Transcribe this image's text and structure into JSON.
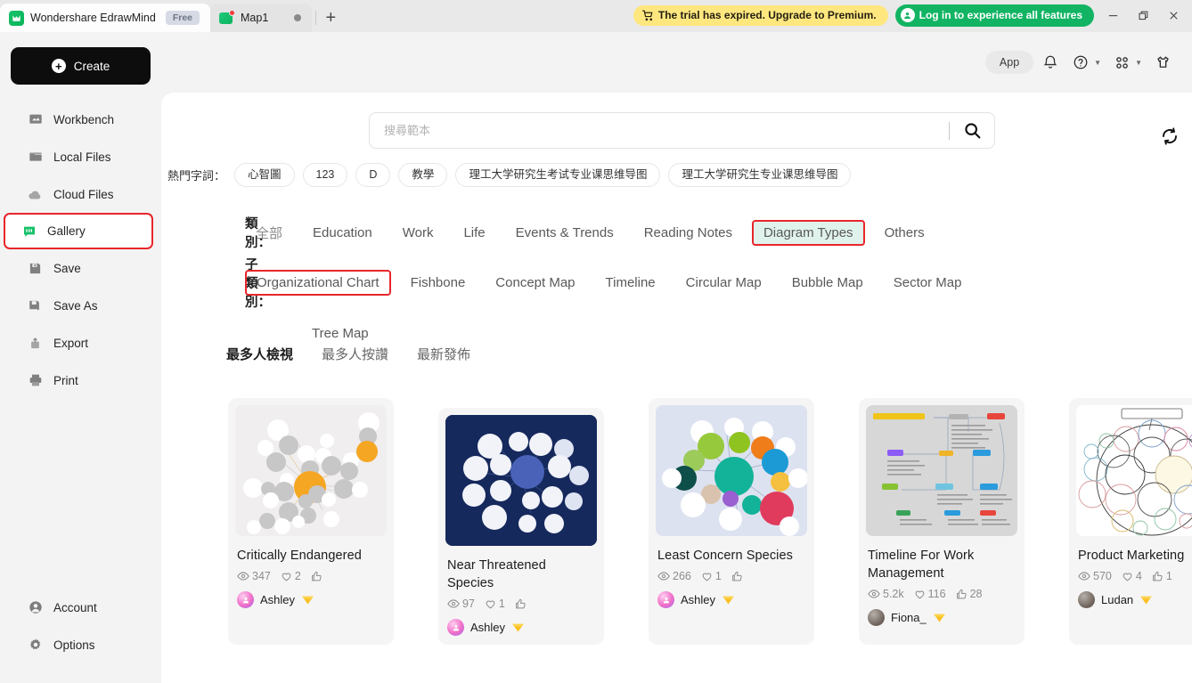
{
  "titlebar": {
    "app_name": "Wondershare EdrawMind",
    "free_badge": "Free",
    "doc_tab": "Map1",
    "add_tab_label": "+",
    "trial_notice": "The trial has expired. Upgrade to Premium.",
    "login_label": "Log in to experience all features",
    "minimize": "minimize-icon",
    "restore": "restore-icon",
    "close": "close-icon"
  },
  "sidebar": {
    "create_label": "Create",
    "items": [
      {
        "label": "Workbench",
        "icon": "workbench-icon"
      },
      {
        "label": "Local Files",
        "icon": "folder-icon"
      },
      {
        "label": "Cloud Files",
        "icon": "cloud-icon"
      },
      {
        "label": "Gallery",
        "icon": "gallery-icon",
        "highlighted": true
      },
      {
        "label": "Save",
        "icon": "save-icon"
      },
      {
        "label": "Save As",
        "icon": "save-as-icon"
      },
      {
        "label": "Export",
        "icon": "export-icon"
      },
      {
        "label": "Print",
        "icon": "print-icon"
      }
    ],
    "bottom_items": [
      {
        "label": "Account",
        "icon": "account-icon"
      },
      {
        "label": "Options",
        "icon": "gear-icon"
      }
    ]
  },
  "topbar": {
    "app_button": "App",
    "bell": "bell-icon",
    "help": "help-icon",
    "apps_grid": "grid-icon",
    "shirt": "shirt-icon"
  },
  "search": {
    "placeholder": "搜尋範本",
    "value": "",
    "search_icon": "search-icon",
    "refresh_icon": "refresh-icon"
  },
  "hot_keywords": {
    "label": "熱門字詞：",
    "items": [
      "心智圖",
      "123",
      "D",
      "教學",
      "理工大学研究生考试专业课思维导图",
      "理工大学研究生专业课思维导图"
    ]
  },
  "categories": {
    "label": "類別：",
    "items": [
      "全部",
      "Education",
      "Work",
      "Life",
      "Events & Trends",
      "Reading Notes",
      "Diagram Types",
      "Others"
    ],
    "selected": "Diagram Types",
    "highlight_color": "#e8262b",
    "selected_bg": "#e0f2ec"
  },
  "subcategories": {
    "label": "子類別：",
    "items": [
      "Organizational Chart",
      "Fishbone",
      "Concept Map",
      "Timeline",
      "Circular Map",
      "Bubble Map",
      "Sector Map",
      "Tree Map"
    ],
    "selected": "Organizational Chart"
  },
  "sort_tabs": {
    "items": [
      "最多人檢視",
      "最多人按讚",
      "最新發佈"
    ],
    "active": "最多人檢視"
  },
  "cards": [
    {
      "title": "Critically Endangered",
      "views": "347",
      "likes": "2",
      "thumbs": "",
      "author": "Ashley",
      "vip": true,
      "thumb_bg": "#f0eeee",
      "thumb_kind": "bubble-grey"
    },
    {
      "title": "Near Threatened Species",
      "views": "97",
      "likes": "1",
      "thumbs": "",
      "author": "Ashley",
      "vip": true,
      "thumb_bg": "#16295c",
      "thumb_kind": "bubble-navy"
    },
    {
      "title": "Least Concern Species",
      "views": "266",
      "likes": "1",
      "thumbs": "",
      "author": "Ashley",
      "vip": true,
      "thumb_bg": "#dde2f0",
      "thumb_kind": "bubble-color"
    },
    {
      "title": "Timeline For Work Management",
      "views": "5.2k",
      "likes": "116",
      "thumbs": "28",
      "author": "Fiona_",
      "vip": true,
      "thumb_bg": "#d7d7d7",
      "thumb_kind": "timeline"
    },
    {
      "title": "Product Marketing",
      "views": "570",
      "likes": "4",
      "thumbs": "1",
      "author": "Ludan",
      "vip": true,
      "thumb_bg": "#ffffff",
      "thumb_kind": "circle-pack"
    }
  ]
}
